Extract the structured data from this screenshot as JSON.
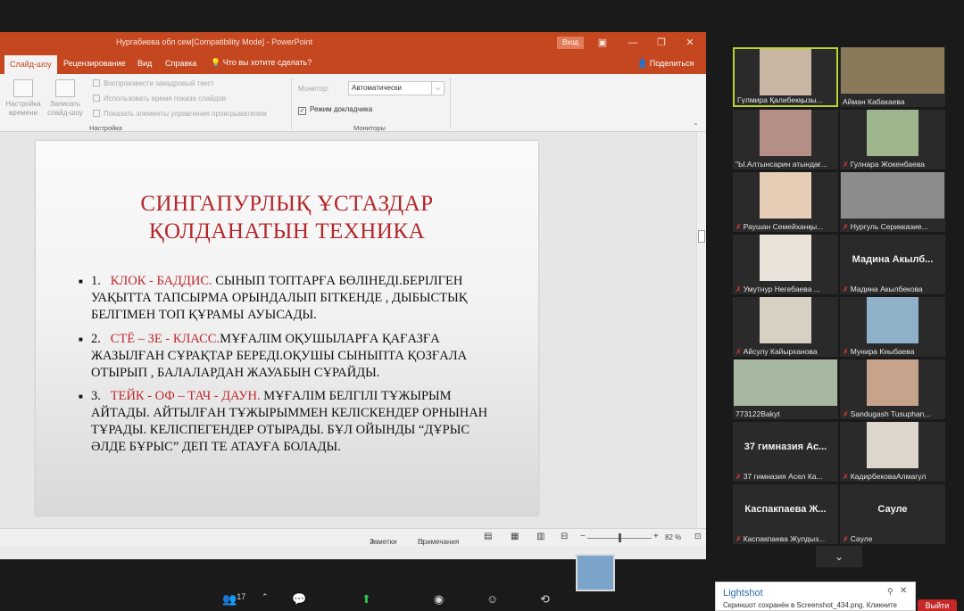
{
  "ppt": {
    "title": "Нургабиева обл сем[Compatibility Mode] - PowerPoint",
    "login": "Вход",
    "tabs": {
      "active": "Слайд-шоу",
      "review": "Рецензирование",
      "view": "Вид",
      "help": "Справка",
      "tell_me": "Что вы хотите сделать?",
      "share": "Поделиться"
    },
    "ribbon": {
      "rehearse": "Настройка времени",
      "record": "Записать слайд-шоу",
      "chk_narration": "Воспроизвести закадровый текст",
      "chk_timings": "Использовать время показа слайдов",
      "chk_controls": "Показать элементы управления проигрывателем",
      "group_setup": "Настройка",
      "monitor_label": "Монитор:",
      "monitor_value": "Автоматически",
      "presenter_view": "Режим докладчика",
      "group_monitors": "Мониторы"
    },
    "slide": {
      "title_line1": "СИНГАПУРЛЫҚ ҰСТАЗДАР",
      "title_line2": "ҚОЛДАНАТЫН  ТЕХНИКА",
      "items": [
        {
          "num": "1.",
          "term": "КЛОК - БАДДИС.",
          "text": " СЫНЫП ТОПТАРҒА БӨЛІНЕДІ.БЕРІЛГЕН УАҚЫТТА ТАПСЫРМА ОРЫНДАЛЫП БІТКЕНДЕ , ДЫБЫСТЫҚ БЕЛГІМЕН ТОП ҚҰРАМЫ АУЫСАДЫ."
        },
        {
          "num": "2.",
          "term": "СТЁ – ЗЕ - КЛАСС.",
          "text": "МҰҒАЛІМ ОҚУШЫЛАРҒА ҚАҒАЗҒА ЖАЗЫЛҒАН СҰРАҚТАР БЕРЕДІ.ОҚУШЫ СЫНЫПТА ҚОЗҒАЛА ОТЫРЫП , БАЛАЛАРДАН ЖАУАБЫН СҰРАЙДЫ."
        },
        {
          "num": "3.",
          "term": "ТЕЙК - ОФ – ТАЧ - ДАУН.",
          "text": " МҰҒАЛІМ БЕЛГІЛІ ТҰЖЫРЫМ АЙТАДЫ. АЙТЫЛҒАН ТҰЖЫРЫММЕН КЕЛІСКЕНДЕР ОРНЫНАН ТҰРАДЫ. КЕЛІСПЕГЕНДЕР ОТЫРАДЫ. БҰЛ ОЙЫНДЫ “ДҰРЫС ӘЛДЕ БҰРЫС” ДЕП ТЕ АТАУҒА БОЛАДЫ."
        }
      ]
    },
    "status": {
      "notes": "Заметки",
      "comments": "Примечания",
      "zoom": "82 %",
      "zoom_level": 0.5
    }
  },
  "participants": {
    "count": "17",
    "tiles": [
      {
        "name": "Гүлмира Қалибекқызы...",
        "big": "",
        "video": true,
        "active": true,
        "muted": false,
        "bg": "#c9b6a3",
        "wide": false
      },
      {
        "name": "Айман Кабакаева",
        "big": "",
        "video": true,
        "active": false,
        "muted": false,
        "bg": "#8a7a5a",
        "wide": true
      },
      {
        "name": "\"Ы.Алтынсарин атындағ...",
        "big": "",
        "video": true,
        "active": false,
        "muted": false,
        "bg": "#b58f86",
        "wide": false
      },
      {
        "name": "Гулнара Жокенбаева",
        "big": "",
        "video": true,
        "active": false,
        "muted": true,
        "bg": "#9fb58e",
        "wide": false
      },
      {
        "name": "Раушан Семейханқы...",
        "big": "",
        "video": true,
        "active": false,
        "muted": true,
        "bg": "#e6cdb6",
        "wide": false
      },
      {
        "name": "Нургуль Серикказие...",
        "big": "",
        "video": true,
        "active": false,
        "muted": true,
        "bg": "#8c8c8c",
        "wide": true
      },
      {
        "name": "Умутнур Негебаева ...",
        "big": "",
        "video": true,
        "active": false,
        "muted": true,
        "bg": "#e9e2d8",
        "wide": false
      },
      {
        "name": "Мадина Акылбекова",
        "big": "Мадина  Акылб...",
        "video": false,
        "active": false,
        "muted": true,
        "bg": "",
        "wide": false
      },
      {
        "name": "Айсулу Кайырханова",
        "big": "",
        "video": true,
        "active": false,
        "muted": true,
        "bg": "#d8d0c2",
        "wide": false
      },
      {
        "name": "Мунира Кныбаева",
        "big": "",
        "video": true,
        "active": false,
        "muted": true,
        "bg": "#8fb0c9",
        "wide": false
      },
      {
        "name": "773122Bakyt",
        "big": "",
        "video": true,
        "active": false,
        "muted": false,
        "bg": "#a8b8a0",
        "wide": true
      },
      {
        "name": "Sandugash Tusuphan...",
        "big": "",
        "video": true,
        "active": false,
        "muted": true,
        "bg": "#c8a38c",
        "wide": false
      },
      {
        "name": "37 гимназия Асел Ка...",
        "big": "37  гимназия  Ас...",
        "video": false,
        "active": false,
        "muted": true,
        "bg": "",
        "wide": false
      },
      {
        "name": "КадирбековаАлмагул",
        "big": "",
        "video": true,
        "active": false,
        "muted": true,
        "bg": "#dcd6cc",
        "wide": false
      },
      {
        "name": "Каспакпаева Жулдыз...",
        "big": "Каспакпаева  Ж...",
        "video": false,
        "active": false,
        "muted": true,
        "bg": "",
        "wide": false
      },
      {
        "name": "Сауле",
        "big": "Сауле",
        "video": false,
        "active": false,
        "muted": true,
        "bg": "",
        "wide": false
      }
    ]
  },
  "lightshot": {
    "title": "Lightshot",
    "message": "Скриншот сохранён в Screenshot_434.png. Кликните"
  },
  "exit_label": "Выйти"
}
